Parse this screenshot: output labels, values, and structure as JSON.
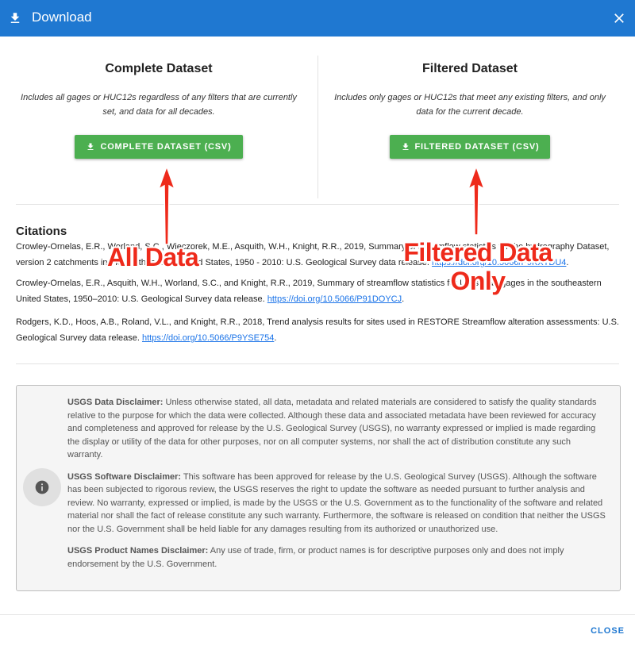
{
  "dialog": {
    "title": "Download",
    "close_label": "CLOSE"
  },
  "complete": {
    "heading": "Complete Dataset",
    "description": "Includes all gages or HUC12s regardless of any filters that are currently set, and data for all decades.",
    "button_label": "COMPLETE DATASET (CSV)"
  },
  "filtered": {
    "heading": "Filtered Dataset",
    "description": "Includes only gages or HUC12s that meet any existing filters, and only data for the current decade.",
    "button_label": "FILTERED DATASET (CSV)"
  },
  "citations": {
    "heading": "Citations",
    "items": [
      {
        "text_before": "Crowley-Ornelas, E.R., Worland, S.C., Wieczorek, M.E., Asquith, W.H., Knight, R.R., 2019, Summary of streamflow statistics for the hydrography Dataset, version 2 catchments in the southeastern United States, 1950 - 2010: U.S. Geological Survey data release. ",
        "link": "https://doi.org/10.5066/P9KXTDU4",
        "text_after": "."
      },
      {
        "text_before": "Crowley-Ornelas, E.R., Asquith, W.H., Worland, S.C., and Knight, R.R., 2019, Summary of streamflow statistics for US streamgages in the southeastern United States, 1950–2010: U.S. Geological Survey data release. ",
        "link": "https://doi.org/10.5066/P91DOYCJ",
        "text_after": "."
      },
      {
        "text_before": "Rodgers, K.D., Hoos, A.B., Roland, V.L., and Knight, R.R., 2018, Trend analysis results for sites used in RESTORE Streamflow alteration assessments: U.S. Geological Survey data release. ",
        "link": "https://doi.org/10.5066/P9YSE754",
        "text_after": "."
      }
    ]
  },
  "disclaimers": [
    {
      "title": "USGS Data Disclaimer:",
      "body": " Unless otherwise stated, all data, metadata and related materials are considered to satisfy the quality standards relative to the purpose for which the data were collected. Although these data and associated metadata have been reviewed for accuracy and completeness and approved for release by the U.S. Geological Survey (USGS), no warranty expressed or implied is made regarding the display or utility of the data for other purposes, nor on all computer systems, nor shall the act of distribution constitute any such warranty."
    },
    {
      "title": "USGS Software Disclaimer:",
      "body": " This software has been approved for release by the U.S. Geological Survey (USGS). Although the software has been subjected to rigorous review, the USGS reserves the right to update the software as needed pursuant to further analysis and review. No warranty, expressed or implied, is made by the USGS or the U.S. Government as to the functionality of the software and related material nor shall the fact of release constitute any such warranty. Furthermore, the software is released on condition that neither the USGS nor the U.S. Government shall be held liable for any damages resulting from its authorized or unauthorized use."
    },
    {
      "title": "USGS Product Names Disclaimer:",
      "body": " Any use of trade, firm, or product names is for descriptive purposes only and does not imply endorsement by the U.S. Government."
    }
  ],
  "annotations": {
    "left": "All Data",
    "right_line1": "Filtered Data",
    "right_line2": "Only",
    "color": "#ee2a1b"
  },
  "colors": {
    "header": "#1f78d1",
    "button": "#4caf50",
    "link": "#1a73e8"
  },
  "icons": {
    "header": "download-icon",
    "close": "close-icon",
    "button": "download-icon",
    "disclaimer": "info-icon"
  }
}
